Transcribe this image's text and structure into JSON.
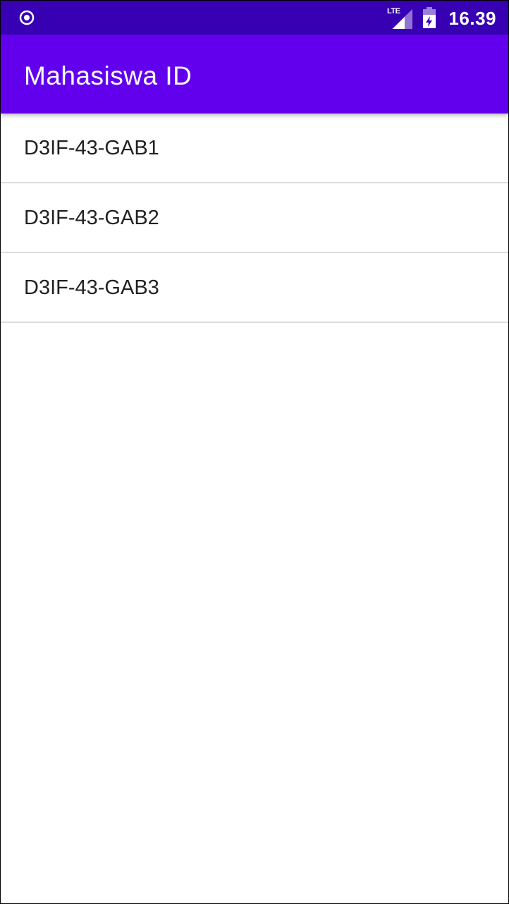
{
  "status_bar": {
    "left_icon": "record-circle-icon",
    "network_label": "LTE",
    "signal_icon": "cell-signal-icon",
    "battery_icon": "battery-charging-icon",
    "time": "16.39",
    "background_color": "#3700b3"
  },
  "app_bar": {
    "title": "Mahasiswa ID",
    "background_color": "#6200ee"
  },
  "list": {
    "items": [
      {
        "label": "D3IF-43-GAB1"
      },
      {
        "label": "D3IF-43-GAB2"
      },
      {
        "label": "D3IF-43-GAB3"
      }
    ]
  }
}
